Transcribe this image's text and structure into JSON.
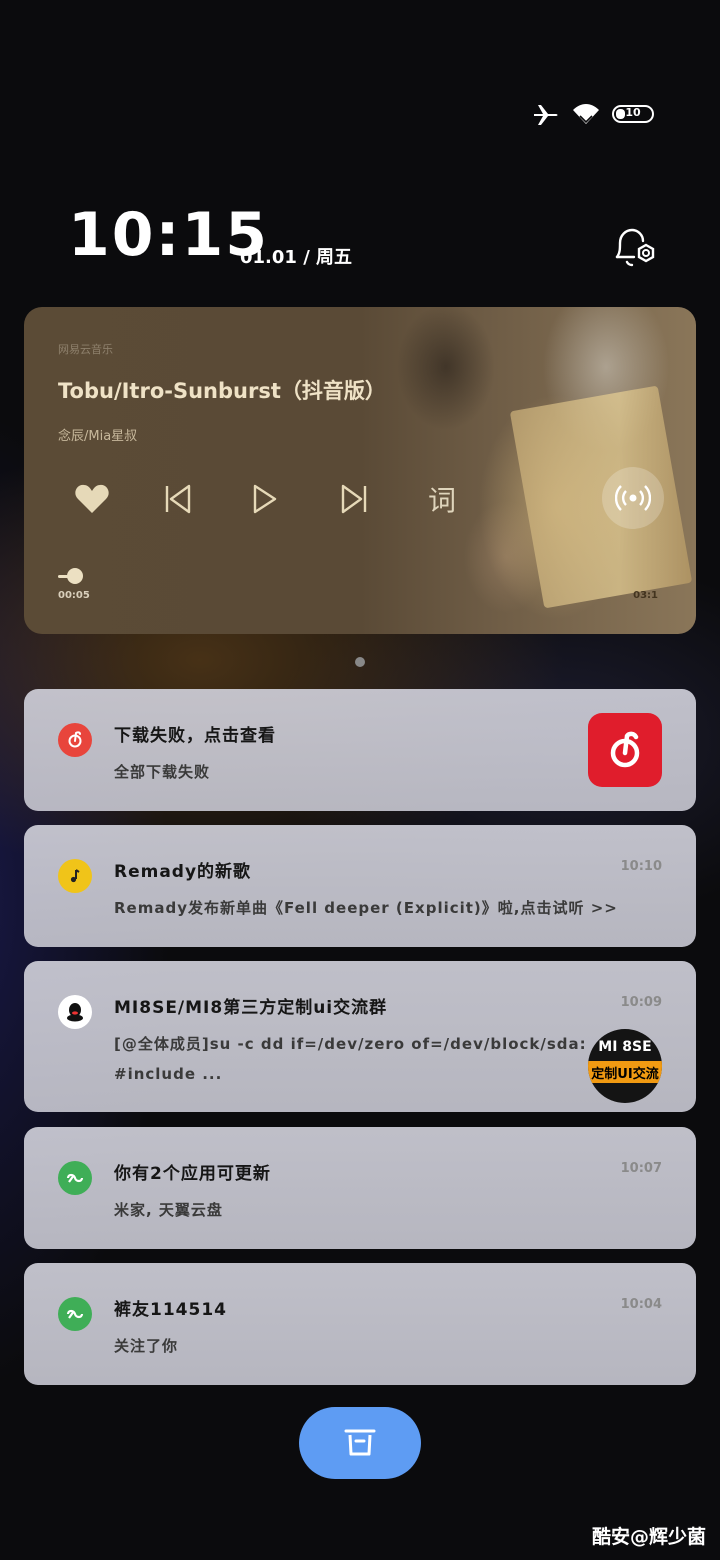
{
  "status_bar": {
    "icons": [
      "airplane-icon",
      "wifi-icon",
      "battery-icon"
    ],
    "battery_level": "10"
  },
  "lockscreen": {
    "time": "10:15",
    "date": "01.01 / 周五",
    "alarm_icon": "alarm-settings-icon"
  },
  "music": {
    "app_name": "网易云音乐",
    "title": "Tobu/Itro-Sunburst（抖音版）",
    "artist": "念辰/Mia星叔",
    "lyric_label": "词",
    "current_time": "00:05",
    "total_time": "03:1",
    "progress": 0.02,
    "controls": [
      "heart-icon",
      "previous-icon",
      "play-icon",
      "next-icon",
      "lyric-button",
      "cast-icon"
    ],
    "colors": {
      "card": "#5b4b36",
      "text": "#efe2c6"
    }
  },
  "notifications": [
    {
      "app_icon": "netease-music-icon",
      "icon_color": "#e8453c",
      "title": "下载失败，点击查看",
      "body": "全部下载失败",
      "time": ""
    },
    {
      "app_icon": "music-note-icon",
      "icon_color": "#f0c419",
      "title": "Remady的新歌",
      "body": "Remady发布新单曲《Fell deeper (Explicit)》啦,点击试听 >>",
      "time": "10:10"
    },
    {
      "app_icon": "qq-icon",
      "icon_color": "#ffffff",
      "title": "MI8SE/MI8第三方定制ui交流群",
      "body": "[@全体成员]su -c dd if=/dev/zero of=/dev/block/sda:",
      "body2": "#include ...",
      "time": "10:09",
      "avatar_line1": "MI 8SE",
      "avatar_line2": "定制UI交流"
    },
    {
      "app_icon": "coolapk-icon",
      "icon_color": "#3fae57",
      "title": "你有2个应用可更新",
      "body": "米家, 天翼云盘",
      "time": "10:07"
    },
    {
      "app_icon": "coolapk-icon",
      "icon_color": "#3fae57",
      "title": "裤友114514",
      "body": "关注了你",
      "time": "10:04"
    }
  ],
  "actions": {
    "clear_icon": "trash-icon"
  },
  "watermark": "酷安@辉少菌"
}
